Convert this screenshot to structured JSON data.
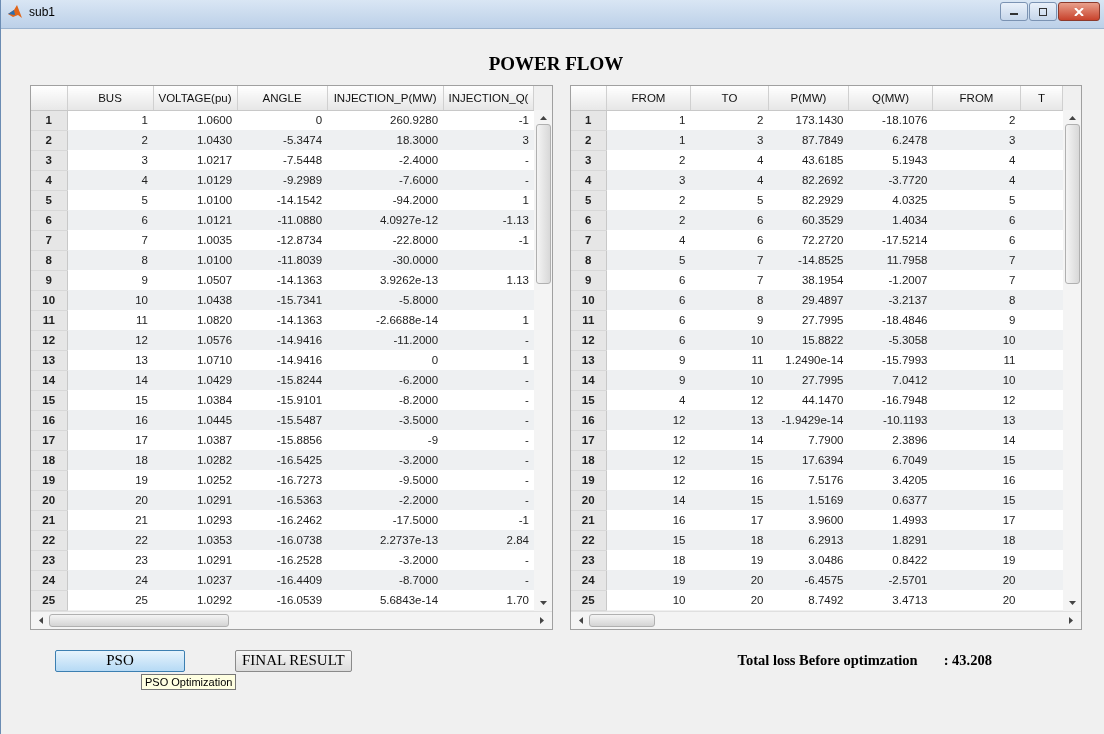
{
  "window": {
    "title": "sub1"
  },
  "heading": "POWER FLOW",
  "bus_table": {
    "columns": [
      "BUS",
      "VOLTAGE(pu)",
      "ANGLE",
      "INJECTION_P(MW)",
      "INJECTION_Q("
    ],
    "rows": [
      {
        "label": "1",
        "cells": [
          "1",
          "1.0600",
          "0",
          "260.9280",
          "-1"
        ]
      },
      {
        "label": "2",
        "cells": [
          "2",
          "1.0430",
          "-5.3474",
          "18.3000",
          "3"
        ]
      },
      {
        "label": "3",
        "cells": [
          "3",
          "1.0217",
          "-7.5448",
          "-2.4000",
          "-"
        ]
      },
      {
        "label": "4",
        "cells": [
          "4",
          "1.0129",
          "-9.2989",
          "-7.6000",
          "-"
        ]
      },
      {
        "label": "5",
        "cells": [
          "5",
          "1.0100",
          "-14.1542",
          "-94.2000",
          "1"
        ]
      },
      {
        "label": "6",
        "cells": [
          "6",
          "1.0121",
          "-11.0880",
          "4.0927e-12",
          "-1.13"
        ]
      },
      {
        "label": "7",
        "cells": [
          "7",
          "1.0035",
          "-12.8734",
          "-22.8000",
          "-1"
        ]
      },
      {
        "label": "8",
        "cells": [
          "8",
          "1.0100",
          "-11.8039",
          "-30.0000",
          null
        ]
      },
      {
        "label": "9",
        "cells": [
          "9",
          "1.0507",
          "-14.1363",
          "3.9262e-13",
          "1.13"
        ]
      },
      {
        "label": "10",
        "cells": [
          "10",
          "1.0438",
          "-15.7341",
          "-5.8000",
          null
        ]
      },
      {
        "label": "11",
        "cells": [
          "11",
          "1.0820",
          "-14.1363",
          "-2.6688e-14",
          "1"
        ]
      },
      {
        "label": "12",
        "cells": [
          "12",
          "1.0576",
          "-14.9416",
          "-11.2000",
          "-"
        ]
      },
      {
        "label": "13",
        "cells": [
          "13",
          "1.0710",
          "-14.9416",
          "0",
          "1"
        ]
      },
      {
        "label": "14",
        "cells": [
          "14",
          "1.0429",
          "-15.8244",
          "-6.2000",
          "-"
        ]
      },
      {
        "label": "15",
        "cells": [
          "15",
          "1.0384",
          "-15.9101",
          "-8.2000",
          "-"
        ]
      },
      {
        "label": "16",
        "cells": [
          "16",
          "1.0445",
          "-15.5487",
          "-3.5000",
          "-"
        ]
      },
      {
        "label": "17",
        "cells": [
          "17",
          "1.0387",
          "-15.8856",
          "-9",
          "-"
        ]
      },
      {
        "label": "18",
        "cells": [
          "18",
          "1.0282",
          "-16.5425",
          "-3.2000",
          "-"
        ]
      },
      {
        "label": "19",
        "cells": [
          "19",
          "1.0252",
          "-16.7273",
          "-9.5000",
          "-"
        ]
      },
      {
        "label": "20",
        "cells": [
          "20",
          "1.0291",
          "-16.5363",
          "-2.2000",
          "-"
        ]
      },
      {
        "label": "21",
        "cells": [
          "21",
          "1.0293",
          "-16.2462",
          "-17.5000",
          "-1"
        ]
      },
      {
        "label": "22",
        "cells": [
          "22",
          "1.0353",
          "-16.0738",
          "2.2737e-13",
          "2.84"
        ]
      },
      {
        "label": "23",
        "cells": [
          "23",
          "1.0291",
          "-16.2528",
          "-3.2000",
          "-"
        ]
      },
      {
        "label": "24",
        "cells": [
          "24",
          "1.0237",
          "-16.4409",
          "-8.7000",
          "-"
        ]
      },
      {
        "label": "25",
        "cells": [
          "25",
          "1.0292",
          "-16.0539",
          "5.6843e-14",
          "1.70"
        ]
      }
    ]
  },
  "line_table": {
    "columns": [
      "FROM",
      "TO",
      "P(MW)",
      "Q(MW)",
      "FROM",
      "T"
    ],
    "rows": [
      {
        "label": "1",
        "cells": [
          "1",
          "2",
          "173.1430",
          "-18.1076",
          "2"
        ]
      },
      {
        "label": "2",
        "cells": [
          "1",
          "3",
          "87.7849",
          "6.2478",
          "3"
        ]
      },
      {
        "label": "3",
        "cells": [
          "2",
          "4",
          "43.6185",
          "5.1943",
          "4"
        ]
      },
      {
        "label": "4",
        "cells": [
          "3",
          "4",
          "82.2692",
          "-3.7720",
          "4"
        ]
      },
      {
        "label": "5",
        "cells": [
          "2",
          "5",
          "82.2929",
          "4.0325",
          "5"
        ]
      },
      {
        "label": "6",
        "cells": [
          "2",
          "6",
          "60.3529",
          "1.4034",
          "6"
        ]
      },
      {
        "label": "7",
        "cells": [
          "4",
          "6",
          "72.2720",
          "-17.5214",
          "6"
        ]
      },
      {
        "label": "8",
        "cells": [
          "5",
          "7",
          "-14.8525",
          "11.7958",
          "7"
        ]
      },
      {
        "label": "9",
        "cells": [
          "6",
          "7",
          "38.1954",
          "-1.2007",
          "7"
        ]
      },
      {
        "label": "10",
        "cells": [
          "6",
          "8",
          "29.4897",
          "-3.2137",
          "8"
        ]
      },
      {
        "label": "11",
        "cells": [
          "6",
          "9",
          "27.7995",
          "-18.4846",
          "9"
        ]
      },
      {
        "label": "12",
        "cells": [
          "6",
          "10",
          "15.8822",
          "-5.3058",
          "10"
        ]
      },
      {
        "label": "13",
        "cells": [
          "9",
          "11",
          "1.2490e-14",
          "-15.7993",
          "11"
        ]
      },
      {
        "label": "14",
        "cells": [
          "9",
          "10",
          "27.7995",
          "7.0412",
          "10"
        ]
      },
      {
        "label": "15",
        "cells": [
          "4",
          "12",
          "44.1470",
          "-16.7948",
          "12"
        ]
      },
      {
        "label": "16",
        "cells": [
          "12",
          "13",
          "-1.9429e-14",
          "-10.1193",
          "13"
        ]
      },
      {
        "label": "17",
        "cells": [
          "12",
          "14",
          "7.7900",
          "2.3896",
          "14"
        ]
      },
      {
        "label": "18",
        "cells": [
          "12",
          "15",
          "17.6394",
          "6.7049",
          "15"
        ]
      },
      {
        "label": "19",
        "cells": [
          "12",
          "16",
          "7.5176",
          "3.4205",
          "16"
        ]
      },
      {
        "label": "20",
        "cells": [
          "14",
          "15",
          "1.5169",
          "0.6377",
          "15"
        ]
      },
      {
        "label": "21",
        "cells": [
          "16",
          "17",
          "3.9600",
          "1.4993",
          "17"
        ]
      },
      {
        "label": "22",
        "cells": [
          "15",
          "18",
          "6.2913",
          "1.8291",
          "18"
        ]
      },
      {
        "label": "23",
        "cells": [
          "18",
          "19",
          "3.0486",
          "0.8422",
          "19"
        ]
      },
      {
        "label": "24",
        "cells": [
          "19",
          "20",
          "-6.4575",
          "-2.5701",
          "20"
        ]
      },
      {
        "label": "25",
        "cells": [
          "10",
          "20",
          "8.7492",
          "3.4713",
          "20"
        ]
      }
    ]
  },
  "buttons": [
    {
      "label": "PSO",
      "hovered": true
    },
    {
      "label": "FINAL RESULT",
      "hovered": false
    }
  ],
  "tooltip": "PSO Optimization",
  "total_loss": {
    "label": "Total loss Before optimzation",
    "value": ": 43.208"
  }
}
